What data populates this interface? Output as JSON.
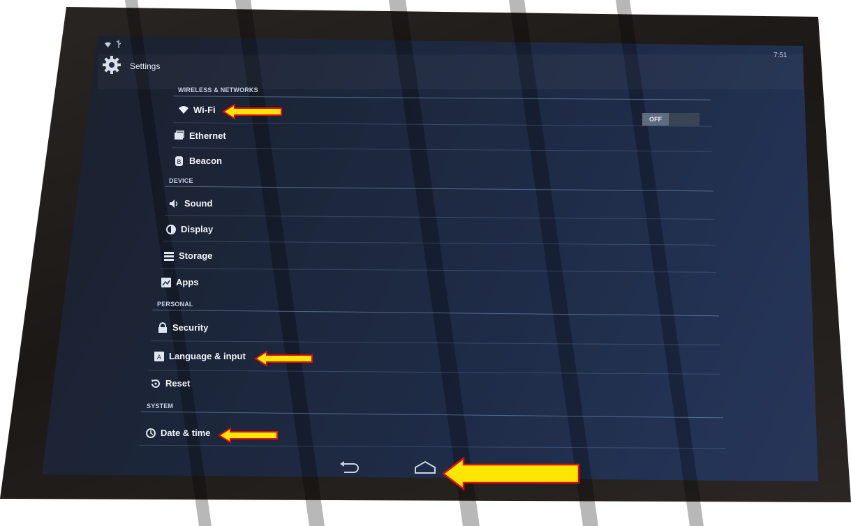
{
  "status_bar": {
    "left_icons": [
      "wifi-icon",
      "usb-icon"
    ],
    "clock": "7:51"
  },
  "action_bar": {
    "icon": "gear-icon",
    "title": "Settings"
  },
  "sections": [
    {
      "header": "WIRELESS & NETWORKS",
      "items": [
        {
          "label": "Wi-Fi",
          "icon": "wifi-icon",
          "toggle": "OFF"
        },
        {
          "label": "Ethernet",
          "icon": "ethernet-icon"
        },
        {
          "label": "Beacon",
          "icon": "beacon-icon"
        }
      ]
    },
    {
      "header": "DEVICE",
      "items": [
        {
          "label": "Sound",
          "icon": "speaker-icon"
        },
        {
          "label": "Display",
          "icon": "display-icon"
        },
        {
          "label": "Storage",
          "icon": "storage-icon"
        },
        {
          "label": "Apps",
          "icon": "apps-icon"
        }
      ]
    },
    {
      "header": "PERSONAL",
      "items": [
        {
          "label": "Security",
          "icon": "lock-icon"
        },
        {
          "label": "Language & input",
          "icon": "keyboard-icon"
        },
        {
          "label": "Reset",
          "icon": "reset-icon"
        }
      ]
    },
    {
      "header": "SYSTEM",
      "items": [
        {
          "label": "Date & time",
          "icon": "clock-icon"
        }
      ]
    }
  ],
  "nav_bar": {
    "buttons": [
      "back-icon",
      "home-icon"
    ]
  },
  "annotations": {
    "arrow_color": "#ffe600",
    "arrow_outline": "#e01010",
    "pointing_to": [
      "Wi-Fi",
      "Language & input",
      "Date & time",
      "home-icon"
    ]
  },
  "colors": {
    "screen_bg": "#1f2c48",
    "divider": "#7c9bc8",
    "text": "#f0f3f8"
  }
}
